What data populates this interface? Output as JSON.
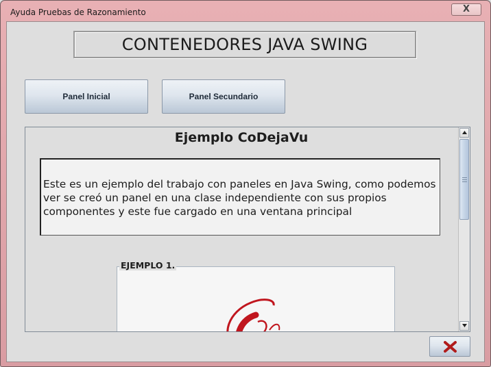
{
  "window": {
    "title": "Ayuda Pruebas de Razonamiento",
    "close_glyph": "X"
  },
  "header": {
    "title": "CONTENEDORES JAVA SWING"
  },
  "buttons": {
    "panel_inicial": "Panel Inicial",
    "panel_secundario": "Panel Secundario"
  },
  "content": {
    "title": "Ejemplo CoDejaVu",
    "description": "Este es un ejemplo del trabajo con paneles en Java Swing, como podemos ver se creó un panel en una clase independiente con sus propios componentes y este fue cargado en una ventana principal",
    "example_label": "EJEMPLO 1."
  },
  "icons": {
    "close_button_icon": "red-x-icon",
    "scroll_up": "arrow-up-icon",
    "scroll_down": "arrow-down-icon"
  },
  "colors": {
    "title_bar": "#e0a6ab",
    "close_x": "#b01c1c",
    "logo_red": "#c0161e"
  }
}
